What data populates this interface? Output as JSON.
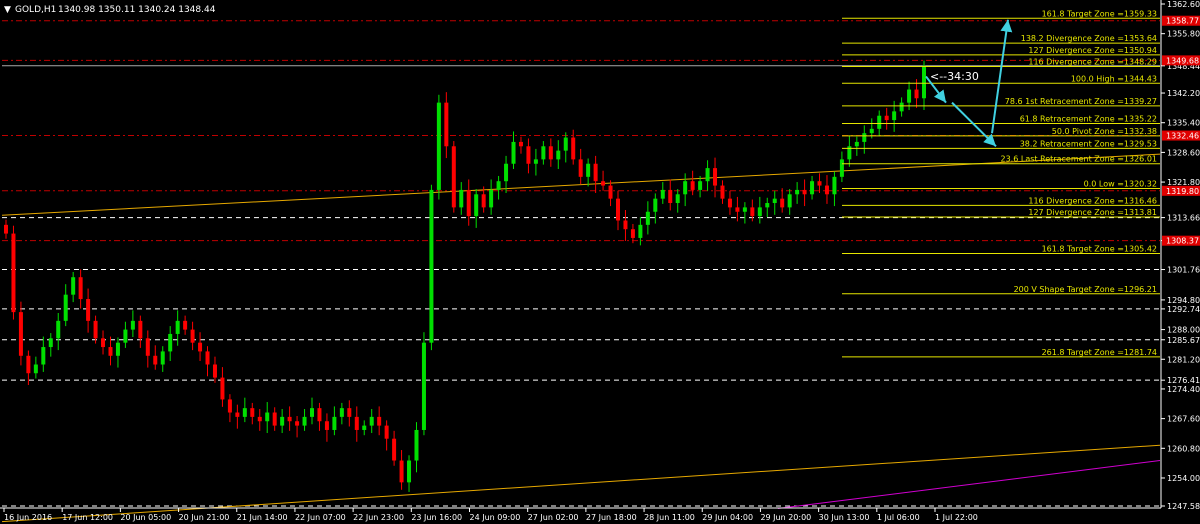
{
  "header": {
    "menu_icon": "triangle-down-icon",
    "symbol": "GOLD,H1",
    "ohlc": "1340.98 1350.11 1340.24 1348.44"
  },
  "colors": {
    "background": "#000000",
    "bull": "#00e000",
    "bear": "#ff0000",
    "fib_line": "#e6e600",
    "fib_label": "#e6e600",
    "trendline": "#e6a800",
    "trendline2": "#d000d0",
    "red_level": "#c00000",
    "white_level": "#ffffff",
    "arrow": "#40d0e0",
    "axis_text": "#ffffff"
  },
  "countdown": "<--34:30",
  "chart_data": {
    "type": "candlestick",
    "y_range": [
      1247.58,
      1362.6
    ],
    "y_ticks": [
      "1362.60",
      "1355.80",
      "1348.44",
      "1342.20",
      "1335.40",
      "1328.60",
      "1321.80",
      "1313.66",
      "1308.40",
      "1301.76",
      "1294.80",
      "1292.74",
      "1288.00",
      "1285.67",
      "1281.20",
      "1276.41",
      "1274.40",
      "1267.60",
      "1260.80",
      "1254.00",
      "1247.58"
    ],
    "x_ticks": [
      "16 Jun 2016",
      "17 Jun 12:00",
      "20 Jun 05:00",
      "20 Jun 21:00",
      "21 Jun 14:00",
      "22 Jun 07:00",
      "22 Jun 23:00",
      "23 Jun 16:00",
      "24 Jun 09:00",
      "27 Jun 02:00",
      "27 Jun 18:00",
      "28 Jun 11:00",
      "29 Jun 04:00",
      "29 Jun 20:00",
      "30 Jun 13:00",
      "1 Jul 06:00",
      "1 Jul 22:00"
    ],
    "price_tags": [
      {
        "text": "1358.77",
        "value": 1358.77,
        "color": "red"
      },
      {
        "text": "1349.68",
        "value": 1349.68,
        "color": "red"
      },
      {
        "text": "1332.46",
        "value": 1332.46,
        "color": "red"
      },
      {
        "text": "1319.80",
        "value": 1319.8,
        "color": "red"
      },
      {
        "text": "1308.37",
        "value": 1308.37,
        "color": "red"
      }
    ],
    "fib_levels": [
      {
        "label": "161.8 Target Zone =1359.33",
        "value": 1359.33
      },
      {
        "label": "138.2 Divergence Zone =1353.64",
        "value": 1353.64
      },
      {
        "label": "127 Divergence Zone =1350.94",
        "value": 1350.94
      },
      {
        "label": "116 Divergence Zone =1348.29",
        "value": 1348.29
      },
      {
        "label": "100.0 High =1344.43",
        "value": 1344.43
      },
      {
        "label": "78.6 1st Retracement Zone =1339.27",
        "value": 1339.27
      },
      {
        "label": "61.8 Retracement Zone =1335.22",
        "value": 1335.22
      },
      {
        "label": "50.0 Pivot Zone =1332.38",
        "value": 1332.38
      },
      {
        "label": "38.2 Retracement Zone =1329.53",
        "value": 1329.53
      },
      {
        "label": "23.6 Last Retracement Zone =1326.01",
        "value": 1326.01
      },
      {
        "label": "0.0 Low =1320.32",
        "value": 1320.32
      },
      {
        "label": "116 Divergence Zone =1316.46",
        "value": 1316.46
      },
      {
        "label": "127 Divergence Zone =1313.81",
        "value": 1313.81
      },
      {
        "label": "161.8 Target Zone =1305.42",
        "value": 1305.42
      },
      {
        "label": "200  V Shape Target Zone =1296.21",
        "value": 1296.21
      },
      {
        "label": "261.8 Target Zone =1281.74",
        "value": 1281.74
      }
    ],
    "red_levels": [
      1358.77,
      1349.68,
      1332.46,
      1319.8,
      1308.37
    ],
    "white_dashed_levels": [
      1313.66,
      1301.76,
      1292.74,
      1285.67,
      1276.41,
      1247.58
    ],
    "white_solid_levels": [
      1348.44
    ],
    "trendlines": [
      {
        "color": "trendline",
        "from": [
          0,
          1314.2
        ],
        "to": [
          1,
          1328.2
        ]
      },
      {
        "color": "trendline",
        "from": [
          0,
          1244.0
        ],
        "to": [
          1,
          1261.5
        ]
      },
      {
        "color": "trendline2",
        "from": [
          0.67,
          1247.0
        ],
        "to": [
          1,
          1258.0
        ]
      }
    ],
    "projection_arrows": [
      {
        "from": [
          1344.43
        ],
        "to": [
          1335.0
        ]
      },
      {
        "from": [
          1335.0
        ],
        "to": [
          1350.5
        ]
      }
    ],
    "closes": [
      1310,
      1292,
      1282,
      1278,
      1280,
      1284,
      1286,
      1290,
      1296,
      1300,
      1295,
      1290,
      1286,
      1284,
      1282,
      1285,
      1288,
      1290,
      1286,
      1282,
      1280,
      1283,
      1287,
      1290,
      1288,
      1285,
      1283,
      1280,
      1277,
      1272,
      1269,
      1268,
      1270,
      1268,
      1267,
      1269,
      1266,
      1268,
      1267,
      1266,
      1268,
      1270,
      1267,
      1265,
      1268,
      1270,
      1268,
      1265,
      1266,
      1268,
      1266,
      1263,
      1258,
      1253,
      1258,
      1265,
      1285,
      1320,
      1340,
      1330,
      1316,
      1320,
      1314,
      1319,
      1316,
      1320,
      1322,
      1326,
      1331,
      1330,
      1326,
      1327,
      1330,
      1327,
      1329,
      1332,
      1327,
      1323,
      1326,
      1322,
      1321,
      1318,
      1313,
      1311,
      1309,
      1312,
      1315,
      1318,
      1320,
      1317,
      1319,
      1322,
      1320,
      1322,
      1325,
      1321,
      1318,
      1316,
      1315,
      1316,
      1314,
      1316,
      1317,
      1318,
      1316,
      1319,
      1320,
      1319,
      1322,
      1321,
      1319,
      1323,
      1327,
      1330,
      1331,
      1333,
      1334,
      1337,
      1336,
      1338,
      1340,
      1343,
      1341,
      1348.44
    ]
  }
}
